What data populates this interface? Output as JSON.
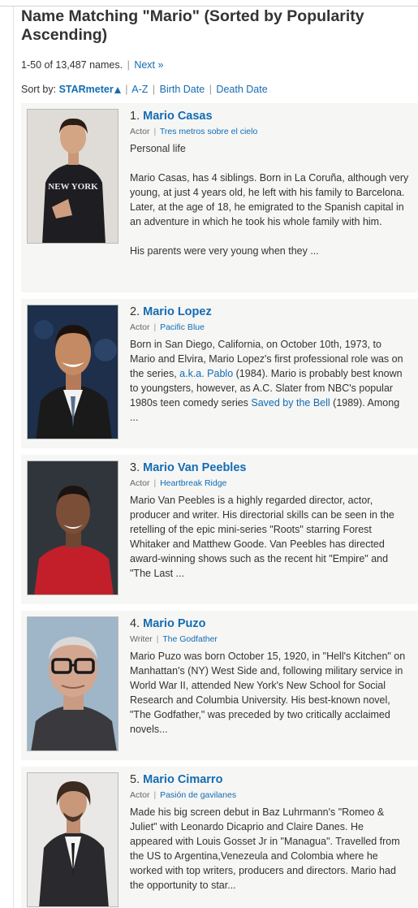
{
  "page": {
    "title": "Name Matching \"Mario\" (Sorted by Popularity Ascending)",
    "count_text": "1-50 of 13,487 names.",
    "next_label": "Next »",
    "sort_label": "Sort by:",
    "sort_options": [
      "STARmeter",
      "A-Z",
      "Birth Date",
      "Death Date"
    ]
  },
  "results": [
    {
      "rank": "1.",
      "name": "Mario Casas",
      "role": "Actor",
      "known_for": "Tres metros sobre el cielo",
      "bio": [
        {
          "t": "Personal life\n\nMario Casas, has 4 siblings. Born in La Coruña, although very young, at just 4 years old, he left with his family to Barcelona. Later, at the age of 18, he emigrated to the Spanish capital in an adventure in which he took his whole family with him.\n\nHis parents were very young when they ..."
        }
      ]
    },
    {
      "rank": "2.",
      "name": "Mario Lopez",
      "role": "Actor",
      "known_for": "Pacific Blue",
      "bio": [
        {
          "t": "Born in San Diego, California, on October 10th, 1973, to Mario and Elvira, Mario Lopez's first professional role was on the series, "
        },
        {
          "l": "a.k.a. Pablo"
        },
        {
          "t": " (1984). Mario is probably best known to youngsters, however, as A.C. Slater from NBC's popular 1980s teen comedy series "
        },
        {
          "l": "Saved by the Bell"
        },
        {
          "t": " (1989). Among ..."
        }
      ]
    },
    {
      "rank": "3.",
      "name": "Mario Van Peebles",
      "role": "Actor",
      "known_for": "Heartbreak Ridge",
      "bio": [
        {
          "t": "Mario Van Peebles is a highly regarded director, actor, producer and writer. His directorial skills can be seen in the retelling of the epic mini-series \"Roots\" starring Forest Whitaker and Matthew Goode. Van Peebles has directed award-winning shows such as the recent hit \"Empire\" and \"The Last ..."
        }
      ]
    },
    {
      "rank": "4.",
      "name": "Mario Puzo",
      "role": "Writer",
      "known_for": "The Godfather",
      "bio": [
        {
          "t": "Mario Puzo was born October 15, 1920, in \"Hell's Kitchen\" on Manhattan's (NY) West Side and, following military service in World War II, attended New York's New School for Social Research and Columbia University. His best-known novel, \"The Godfather,\" was preceded by two critically acclaimed novels..."
        }
      ]
    },
    {
      "rank": "5.",
      "name": "Mario Cimarro",
      "role": "Actor",
      "known_for": "Pasión de gavilanes",
      "bio": [
        {
          "t": "Made his big screen debut in Baz Luhrmann's \"Romeo & Juliet\" with Leonardo Dicaprio and Claire Danes. He appeared with Louis Gosset Jr in \"Managua\". Travelled from the US to Argentina,Venezeula and Colombia where he worked with top writers, producers and directors. Mario had the opportunity to star..."
        }
      ]
    }
  ]
}
